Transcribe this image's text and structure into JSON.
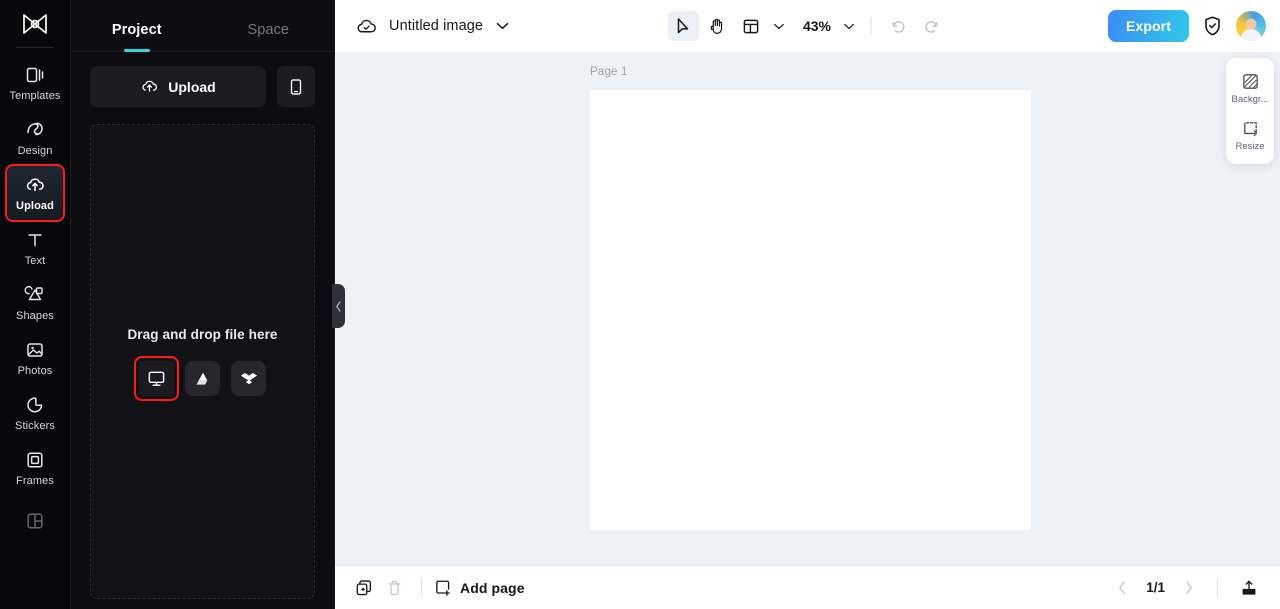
{
  "app": {
    "logo": "capcut-logo"
  },
  "rail": {
    "items": [
      {
        "label": "Templates",
        "icon": "templates-icon",
        "active": false
      },
      {
        "label": "Design",
        "icon": "design-icon",
        "active": false
      },
      {
        "label": "Upload",
        "icon": "upload-cloud-icon",
        "active": true
      },
      {
        "label": "Text",
        "icon": "text-icon",
        "active": false
      },
      {
        "label": "Shapes",
        "icon": "shapes-icon",
        "active": false
      },
      {
        "label": "Photos",
        "icon": "photos-icon",
        "active": false
      },
      {
        "label": "Stickers",
        "icon": "stickers-icon",
        "active": false
      },
      {
        "label": "Frames",
        "icon": "frames-icon",
        "active": false
      },
      {
        "label": "",
        "icon": "layout-grid-icon",
        "active": false
      }
    ]
  },
  "panel": {
    "tabs": [
      {
        "label": "Project",
        "active": true
      },
      {
        "label": "Space",
        "active": false
      }
    ],
    "upload_button": "Upload",
    "mobile_button_icon": "mobile-device-icon",
    "dropzone": {
      "text": "Drag and drop file here",
      "sources": [
        {
          "name": "this-computer",
          "icon": "monitor-icon",
          "highlighted": true
        },
        {
          "name": "google-drive",
          "icon": "google-drive-icon",
          "highlighted": false
        },
        {
          "name": "dropbox",
          "icon": "dropbox-icon",
          "highlighted": false
        }
      ]
    },
    "collapse_icon": "chevron-left-icon"
  },
  "topbar": {
    "cloud_icon": "cloud-saved-icon",
    "doc_title": "Untitled image",
    "title_caret": "chevron-down-icon",
    "tools": [
      {
        "name": "select-tool",
        "icon": "cursor-arrow-icon",
        "selected": true
      },
      {
        "name": "hand-tool",
        "icon": "hand-icon",
        "selected": false
      }
    ],
    "layout_icon": "layout-icon",
    "layout_caret": "chevron-down-icon",
    "zoom_value": "43%",
    "zoom_caret": "chevron-down-icon",
    "undo_icon": "undo-icon",
    "redo_icon": "redo-icon",
    "export_label": "Export",
    "shield_icon": "shield-check-icon",
    "avatar": "user-avatar"
  },
  "canvas": {
    "page_label": "Page 1",
    "float_tools": [
      {
        "label": "Backgr...",
        "icon": "background-icon"
      },
      {
        "label": "Resize",
        "icon": "resize-icon"
      }
    ]
  },
  "bottombar": {
    "duplicate_icon": "duplicate-page-icon",
    "delete_icon": "trash-icon",
    "add_page_label": "Add page",
    "add_page_icon": "add-page-icon",
    "prev_icon": "chevron-left-icon",
    "pager": "1/1",
    "next_icon": "chevron-right-icon",
    "export_icon": "export-upload-icon"
  },
  "colors": {
    "accent_cyan": "#2fd8e0",
    "highlight_red": "#ff1a1a",
    "export_gradient_from": "#3c8cf5",
    "export_gradient_to": "#2fc8e8",
    "canvas_bg": "#eff2f5",
    "panel_bg": "#0d0d11"
  }
}
